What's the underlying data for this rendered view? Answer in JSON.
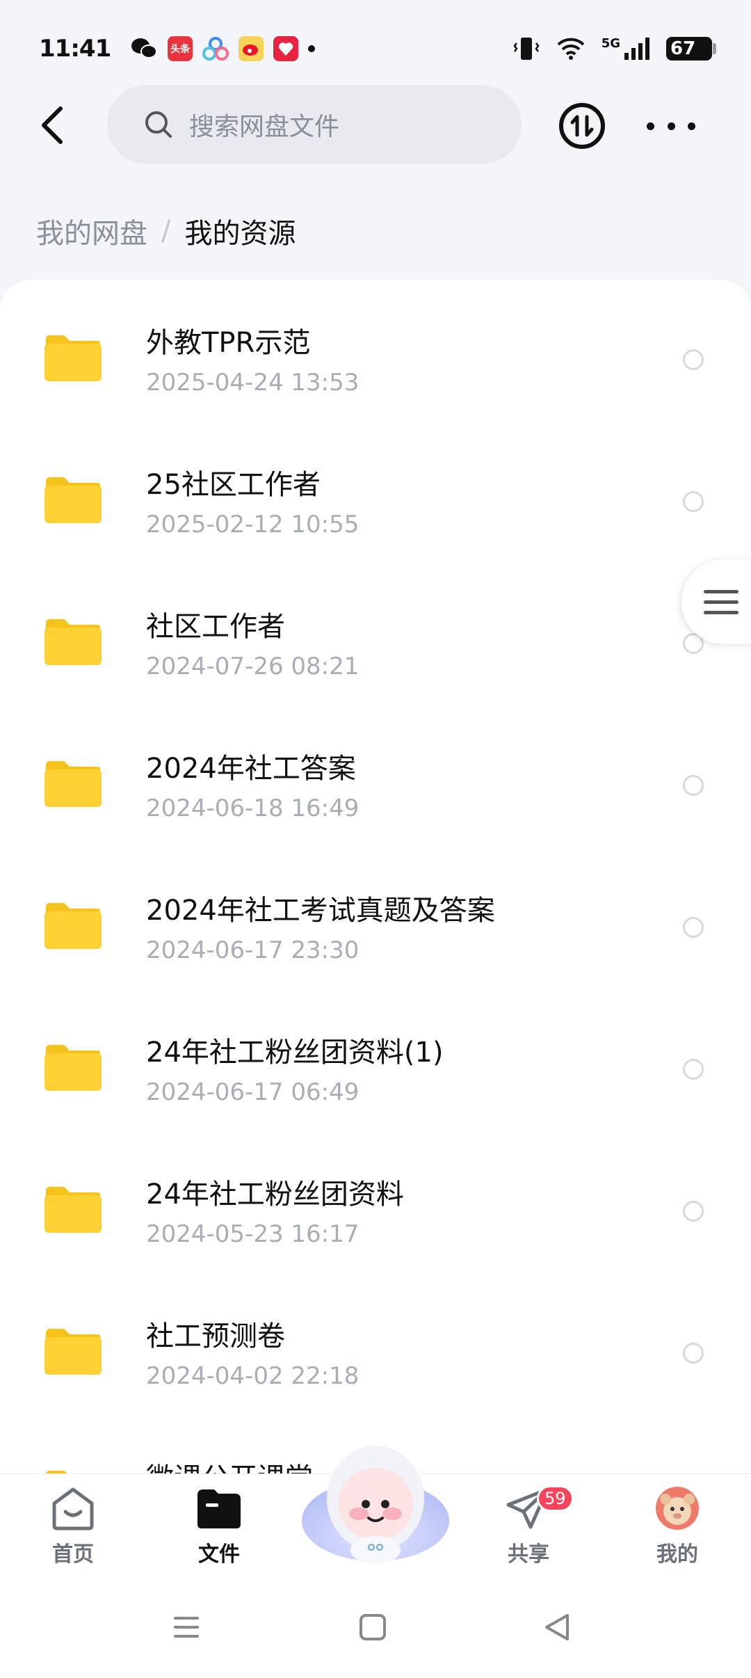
{
  "status_bar": {
    "time": "11:41",
    "network": "5G",
    "battery": "67",
    "apps": [
      "wechat-icon",
      "toutiao-icon",
      "baidu-netdisk-icon",
      "weibo-icon",
      "xiaohongshu-icon"
    ],
    "toutiao_label": "头条"
  },
  "header": {
    "search_placeholder": "搜索网盘文件"
  },
  "breadcrumb": {
    "root": "我的网盘",
    "separator": "/",
    "current": "我的资源"
  },
  "files": [
    {
      "name": "外教TPR示范",
      "date": "2025-04-24  13:53"
    },
    {
      "name": "25社区工作者",
      "date": "2025-02-12  10:55"
    },
    {
      "name": "社区工作者",
      "date": "2024-07-26  08:21"
    },
    {
      "name": "2024年社工答案",
      "date": "2024-06-18  16:49"
    },
    {
      "name": "2024年社工考试真题及答案",
      "date": "2024-06-17  23:30"
    },
    {
      "name": "24年社工粉丝团资料(1)",
      "date": "2024-06-17  06:49"
    },
    {
      "name": "24年社工粉丝团资料",
      "date": "2024-05-23  16:17"
    },
    {
      "name": "社工预测卷",
      "date": "2024-04-02  22:18"
    },
    {
      "name": "微课公开课堂",
      "date": ""
    }
  ],
  "bottom_nav": {
    "home": "首页",
    "files": "文件",
    "share": "共享",
    "share_badge": "59",
    "mine": "我的"
  },
  "colors": {
    "folder": "#fdd034",
    "badge": "#f5445b",
    "background": "#f4f5f8"
  }
}
